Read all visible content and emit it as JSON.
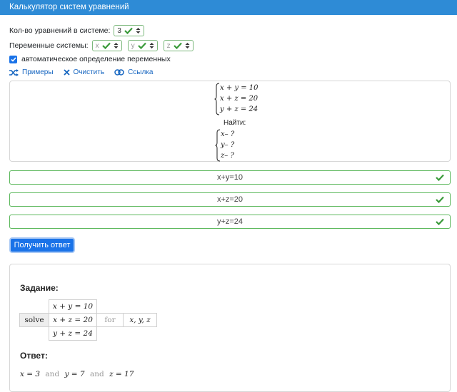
{
  "header": {
    "title": "Калькулятор систем уравнений"
  },
  "controls": {
    "count_label": "Кол-во уравнений в системе:",
    "count_value": "3",
    "vars_label": "Переменные системы:",
    "vars": [
      "x",
      "y",
      "z"
    ],
    "auto_label": "автоматическое определение переменных",
    "auto_checked": true
  },
  "links": {
    "examples": "Примеры",
    "clear": "Очистить",
    "link": "Ссылка"
  },
  "preview": {
    "equations": [
      "x + y = 10",
      "x + z = 20",
      "y + z = 24"
    ],
    "find_label": "Найти:",
    "unknowns": [
      "x– ?",
      "y– ?",
      "z– ?"
    ]
  },
  "inputs": [
    "x+y=10",
    "x+z=20",
    "y+z=24"
  ],
  "submit_label": "Получить ответ",
  "result": {
    "task_label": "Задание:",
    "solve": "solve",
    "equations": [
      "x + y = 10",
      "x + z = 20",
      "y + z = 24"
    ],
    "for": "for",
    "vars": "x, y, z",
    "answer_label": "Ответ:",
    "answer": {
      "x": "x = 3",
      "y": "y = 7",
      "z": "z = 17",
      "and": "and"
    }
  },
  "colors": {
    "header": "#2e8bd6",
    "valid": "#5cb85c",
    "button": "#1a73e8",
    "link": "#1565c0"
  }
}
